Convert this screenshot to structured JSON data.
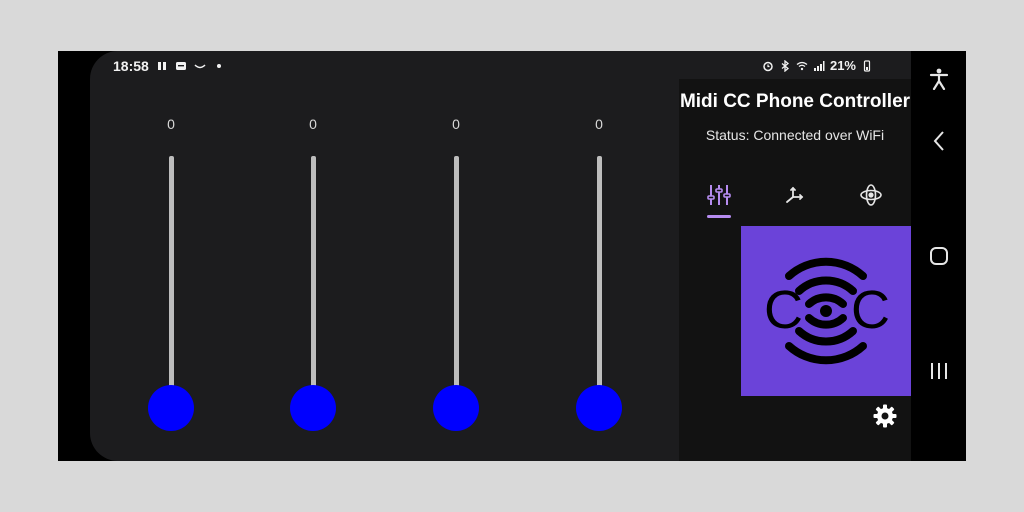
{
  "status_bar": {
    "time": "18:58",
    "left_icons": [
      "sync-icon",
      "message-icon",
      "wave-icon",
      "dot-icon"
    ],
    "right_icons": [
      "alarm-icon",
      "bluetooth-icon",
      "wifi-icon",
      "signal-icon"
    ],
    "battery_percent": "21%"
  },
  "sliders": [
    {
      "value_label": "0",
      "level": 0
    },
    {
      "value_label": "0",
      "level": 0
    },
    {
      "value_label": "0",
      "level": 0
    },
    {
      "value_label": "0",
      "level": 0
    }
  ],
  "panel": {
    "title": "Midi CC Phone Controller",
    "status": "Status: Connected over WiFi",
    "tabs": [
      {
        "icon": "sliders-icon",
        "selected": true
      },
      {
        "icon": "axes-icon",
        "selected": false
      },
      {
        "icon": "gyro-icon",
        "selected": false
      }
    ],
    "logo_text": [
      "C",
      "C"
    ],
    "settings_icon": "gear-icon"
  },
  "navigation_bar": [
    "accessibility-icon",
    "back-icon",
    "home-icon",
    "recents-icon"
  ],
  "colors": {
    "background": "#1c1c1e",
    "slider_thumb": "#0000ff",
    "slider_track": "#bdbdbd",
    "accent": "#b68cf0",
    "logo_background": "#6b43d9"
  }
}
